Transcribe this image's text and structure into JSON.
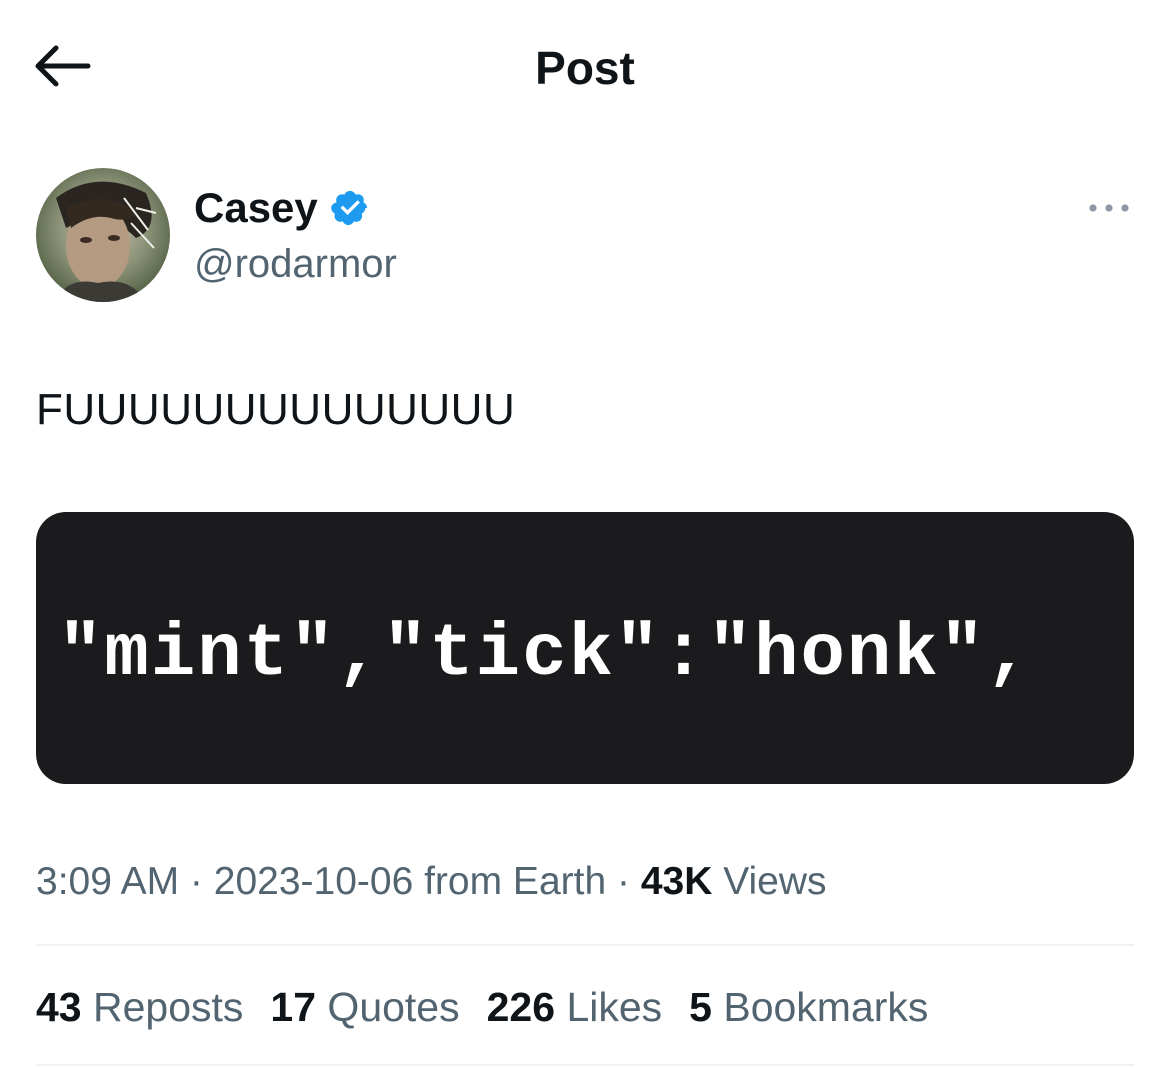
{
  "header": {
    "title": "Post",
    "back_icon": "arrow-left-icon"
  },
  "author": {
    "display_name": "Casey",
    "handle": "@rodarmor",
    "verified_icon": "verified-badge-icon",
    "verified_color": "#1d9bf0"
  },
  "more_icon": "more-horizontal-icon",
  "tweet": {
    "text": "FUUUUUUUUUUUUUU",
    "image_text": "\"mint\",\"tick\":\"honk\","
  },
  "meta": {
    "time": "3:09 AM",
    "separator1": " · ",
    "date_source": "2023-10-06 from Earth",
    "separator2": " · ",
    "views_count": "43K",
    "views_label": " Views"
  },
  "stats": [
    {
      "count": "43",
      "label": " Reposts"
    },
    {
      "count": "17",
      "label": " Quotes"
    },
    {
      "count": "226",
      "label": " Likes"
    },
    {
      "count": "5",
      "label": " Bookmarks"
    }
  ]
}
